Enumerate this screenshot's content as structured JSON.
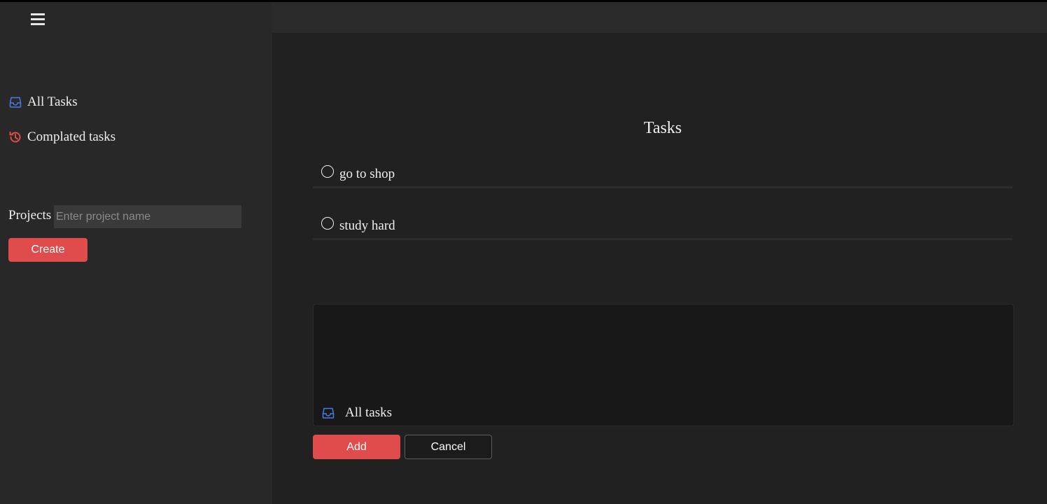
{
  "sidebar": {
    "menu_icon": "hamburger-icon",
    "nav": [
      {
        "label": "All Tasks",
        "icon": "inbox-icon",
        "icon_color": "#4a7be0"
      },
      {
        "label": "Complated tasks",
        "icon": "history-icon",
        "icon_color": "#e04b4b"
      }
    ],
    "projects_label": "Projects",
    "project_input_placeholder": "Enter project name",
    "create_label": "Create"
  },
  "main": {
    "title": "Tasks",
    "tasks": [
      {
        "text": "go to shop",
        "done": false
      },
      {
        "text": "study hard",
        "done": false
      }
    ],
    "editor": {
      "value": "",
      "project_label": "All tasks",
      "project_icon": "inbox-icon"
    },
    "add_label": "Add",
    "cancel_label": "Cancel"
  },
  "colors": {
    "accent": "#e04b4b",
    "inbox_icon": "#4a7be0",
    "sidebar_bg": "#282828",
    "main_bg": "#212121",
    "editor_bg": "#181818"
  }
}
